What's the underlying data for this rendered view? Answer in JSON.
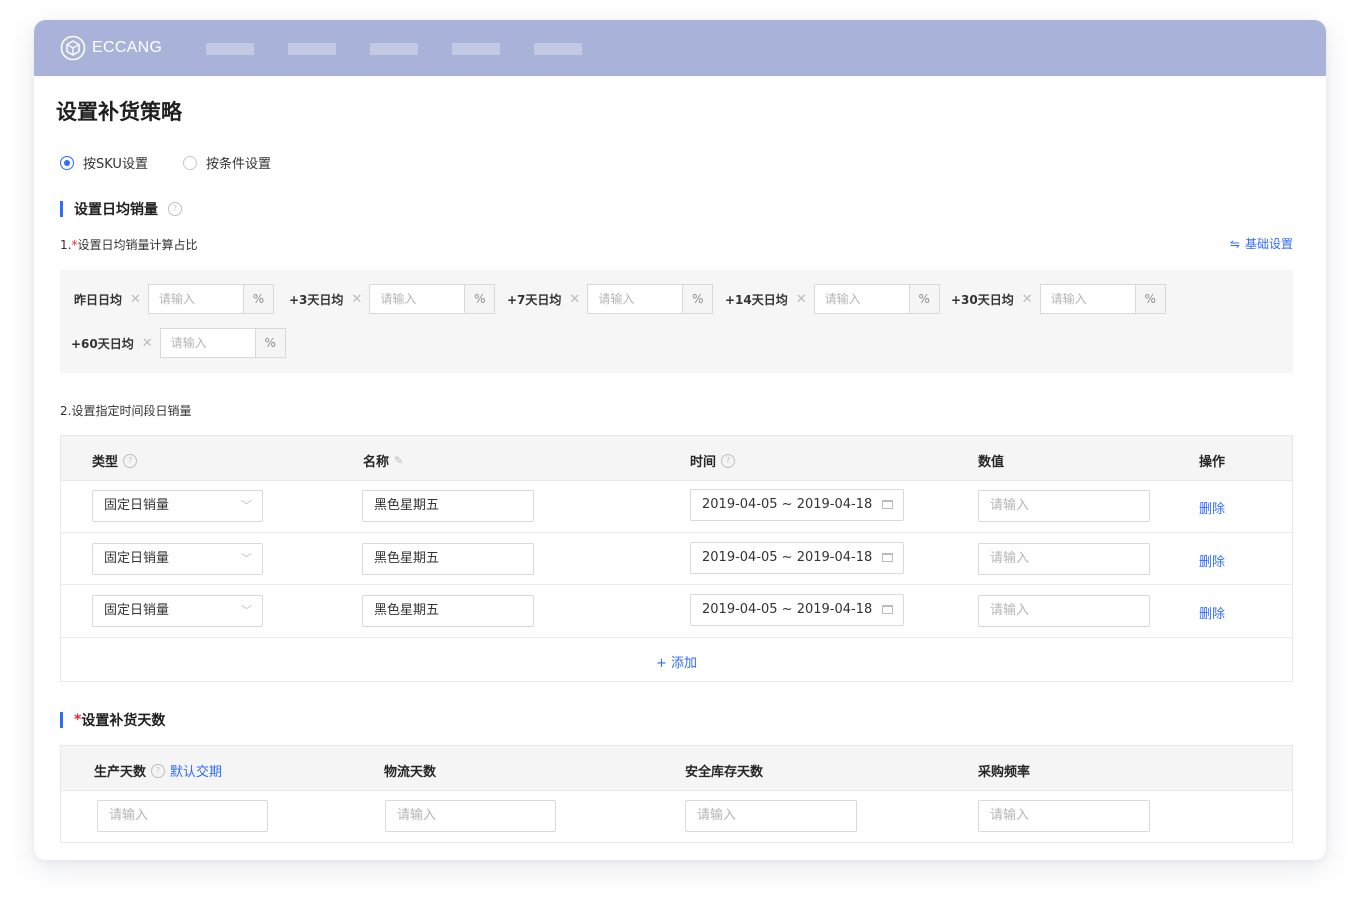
{
  "header": {
    "brand": "ECCANG",
    "nav_placeholders": 5
  },
  "page": {
    "title": "设置补货策略"
  },
  "mode": {
    "options": [
      {
        "label": "按SKU设置",
        "checked": true
      },
      {
        "label": "按条件设置",
        "checked": false
      }
    ]
  },
  "daily_sales": {
    "heading": "设置日均销量",
    "step1_prefix": "1.",
    "step1_required": "*",
    "step1_label": "设置日均销量计算占比",
    "basic_settings_link": "基础设置",
    "ratio_items": [
      {
        "label": "昨日日均",
        "placeholder": "请输入",
        "suffix": "%"
      },
      {
        "label": "+3天日均",
        "placeholder": "请输入",
        "suffix": "%"
      },
      {
        "label": "+7天日均",
        "placeholder": "请输入",
        "suffix": "%"
      },
      {
        "label": "+14天日均",
        "placeholder": "请输入",
        "suffix": "%"
      },
      {
        "label": "+30天日均",
        "placeholder": "请输入",
        "suffix": "%"
      },
      {
        "label": "+60天日均",
        "placeholder": "请输入",
        "suffix": "%"
      }
    ],
    "step2_label": "2.设置指定时间段日销量",
    "table": {
      "columns": {
        "type": "类型",
        "name": "名称",
        "time": "时间",
        "value": "数值",
        "action": "操作"
      },
      "rows": [
        {
          "type": "固定日销量",
          "name": "黑色星期五",
          "date_range": "2019-04-05 ~ 2019-04-18",
          "value_placeholder": "请输入",
          "action": "删除"
        },
        {
          "type": "固定日销量",
          "name": "黑色星期五",
          "date_range": "2019-04-05 ~ 2019-04-18",
          "value_placeholder": "请输入",
          "action": "删除"
        },
        {
          "type": "固定日销量",
          "name": "黑色星期五",
          "date_range": "2019-04-05 ~ 2019-04-18",
          "value_placeholder": "请输入",
          "action": "删除"
        }
      ],
      "add_label": "+ 添加"
    }
  },
  "restock_days": {
    "required": "*",
    "heading": "设置补货天数",
    "columns": {
      "production": "生产天数",
      "default_lead": "默认交期",
      "logistics": "物流天数",
      "safety": "安全库存天数",
      "frequency": "采购频率"
    },
    "placeholders": {
      "production": "请输入",
      "logistics": "请输入",
      "safety": "请输入",
      "frequency": "请输入"
    }
  },
  "icons": [
    "logo-icon",
    "help-icon",
    "swap-icon",
    "close-icon",
    "chevron-down-icon",
    "calendar-icon",
    "edit-icon"
  ],
  "colors": {
    "topbar": "#a9b3d9",
    "accent": "#2f6bff",
    "required": "#f5222d"
  }
}
